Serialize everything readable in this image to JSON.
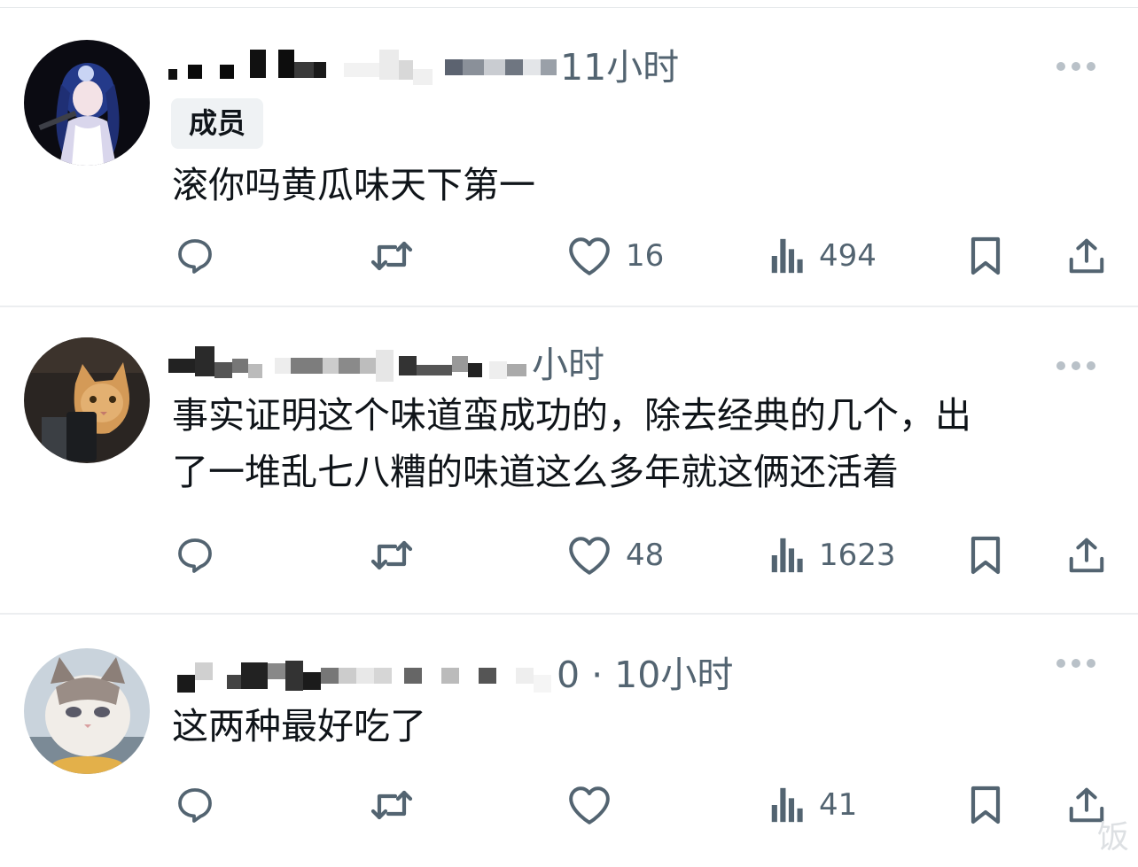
{
  "posts": [
    {
      "time": "11小时",
      "badge": "成员",
      "content": [
        "滚你吗黄瓜味天下第一"
      ],
      "actions": {
        "like_count": "16",
        "views_count": "494"
      }
    },
    {
      "time": "小时",
      "badge": "",
      "content": [
        "事实证明这个味道蛮成功的，除去经典的几个，出",
        "了一堆乱七八糟的味道这么多年就这俩还活着"
      ],
      "actions": {
        "like_count": "48",
        "views_count": "1623"
      }
    },
    {
      "time": "0 · 10小时",
      "badge": "",
      "content": [
        "这两种最好吃了"
      ],
      "actions": {
        "like_count": "",
        "views_count": "41"
      }
    }
  ],
  "watermark": "饭",
  "colors": {
    "text": "#0f1419",
    "secondary": "#536471",
    "divider": "#eceef0",
    "badge_bg": "#eff2f4"
  },
  "icons": [
    "reply-icon",
    "retweet-icon",
    "heart-icon",
    "views-icon",
    "bookmark-icon",
    "share-icon",
    "more-icon"
  ]
}
